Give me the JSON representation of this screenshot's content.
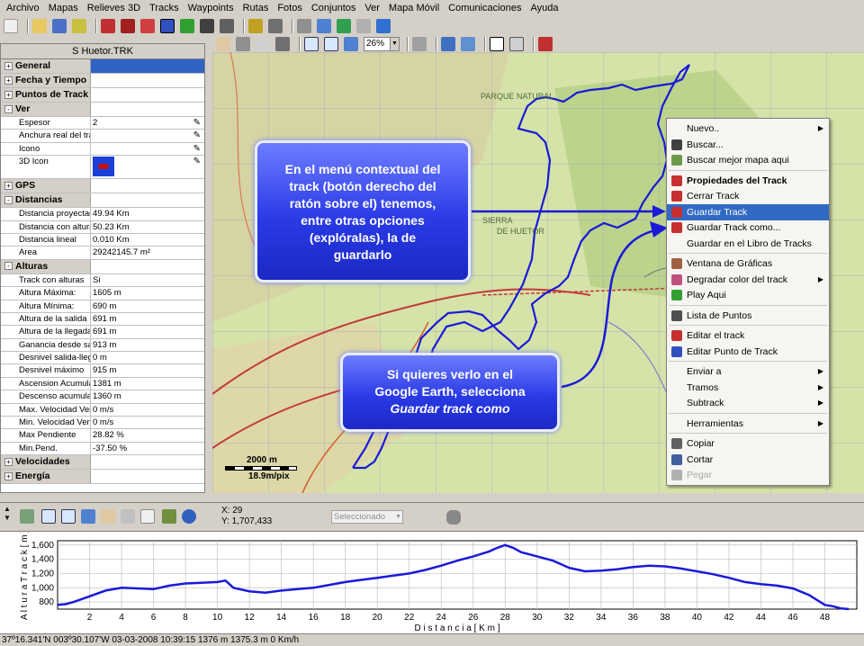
{
  "menubar": [
    "Archivo",
    "Mapas",
    "Relieves 3D",
    "Tracks",
    "Waypoints",
    "Rutas",
    "Fotos",
    "Conjuntos",
    "Ver",
    "Mapa Móvil",
    "Comunicaciones",
    "Ayuda"
  ],
  "toolbar": {
    "zoom": "26%"
  },
  "panel": {
    "title": "S Huetor.TRK",
    "rows": [
      {
        "type": "group",
        "label": "General",
        "pm": "+",
        "value": "",
        "selected": true
      },
      {
        "type": "group",
        "label": "Fecha y Tiempo",
        "pm": "+",
        "value": ""
      },
      {
        "type": "group",
        "label": "Puntos de Track",
        "pm": "+",
        "value": ""
      },
      {
        "type": "group",
        "label": "Ver",
        "pm": "-",
        "value": ""
      },
      {
        "type": "prop",
        "label": "Espesor",
        "value": "2",
        "pencil": true
      },
      {
        "type": "prop",
        "label": "Anchura real del track",
        "value": "",
        "pencil": true
      },
      {
        "type": "prop",
        "label": "Icono",
        "value": "",
        "pencil": true
      },
      {
        "type": "prop3d",
        "label": "3D Icon",
        "value": "",
        "pencil": true
      },
      {
        "type": "group",
        "label": "GPS",
        "pm": "+",
        "value": ""
      },
      {
        "type": "group",
        "label": "Distancias",
        "pm": "-",
        "value": ""
      },
      {
        "type": "prop",
        "label": "Distancia proyectada",
        "value": "49.94 Km"
      },
      {
        "type": "prop",
        "label": "Distancia con alturas",
        "value": "50.23 Km"
      },
      {
        "type": "prop",
        "label": "Distancia lineal",
        "value": "0.010 Km"
      },
      {
        "type": "prop",
        "label": "Area",
        "value": "29242145.7 m²"
      },
      {
        "type": "group",
        "label": "Alturas",
        "pm": "-",
        "value": ""
      },
      {
        "type": "prop",
        "label": "Track con alturas",
        "value": "Si"
      },
      {
        "type": "prop",
        "label": "Altura Máxima:",
        "value": "1605 m"
      },
      {
        "type": "prop",
        "label": "Altura Mínima:",
        "value": "690 m"
      },
      {
        "type": "prop",
        "label": "Altura de la salida",
        "value": "691 m"
      },
      {
        "type": "prop",
        "label": "Altura de la llegada",
        "value": "691 m"
      },
      {
        "type": "prop",
        "label": "Ganancia desde salida",
        "value": "913 m"
      },
      {
        "type": "prop",
        "label": "Desnivel salida-llegada",
        "value": "0 m"
      },
      {
        "type": "prop",
        "label": "Desnivel máximo",
        "value": "915 m"
      },
      {
        "type": "prop",
        "label": "Ascension Acumulada",
        "value": "1381 m"
      },
      {
        "type": "prop",
        "label": "Descenso acumulado",
        "value": "1360 m"
      },
      {
        "type": "prop",
        "label": "Max. Velocidad Vertical",
        "value": "0 m/s"
      },
      {
        "type": "prop",
        "label": "Min. Velocidad Vertical",
        "value": "0 m/s"
      },
      {
        "type": "prop",
        "label": "Max Pendiente",
        "value": "28.82 %"
      },
      {
        "type": "prop",
        "label": "Min.Pend.",
        "value": "-37.50 %"
      },
      {
        "type": "group",
        "label": "Velocidades",
        "pm": "+",
        "value": ""
      },
      {
        "type": "group",
        "label": "Energía",
        "pm": "+",
        "value": ""
      }
    ]
  },
  "map": {
    "scale_label": "2000 m",
    "resolution": "18.9m/pix",
    "labels": [
      "PARQUE NATURAL",
      "SIERRA",
      "DE HUETOR"
    ]
  },
  "context_menu": [
    {
      "label": "Nuevo..",
      "arrow": true,
      "icon": null
    },
    {
      "label": "Buscar...",
      "icon": "binoculars-icon"
    },
    {
      "label": "Buscar mejor mapa aqui",
      "icon": "map-search-icon"
    },
    {
      "sep": true
    },
    {
      "label": "Propiedades del Track",
      "bold": true,
      "icon": "track-icon"
    },
    {
      "label": "Cerrar Track",
      "icon": "track-icon"
    },
    {
      "label": "Guardar Track",
      "highlight": true,
      "icon": "track-save-icon"
    },
    {
      "label": "Guardar Track como...",
      "icon": "track-save-icon"
    },
    {
      "label": "Guardar en el Libro de Tracks",
      "icon": null
    },
    {
      "sep": true
    },
    {
      "label": "Ventana de Gráficas",
      "icon": "chart-icon"
    },
    {
      "label": "Degradar color del track",
      "arrow": true,
      "icon": "gradient-icon"
    },
    {
      "label": "Play Aqui",
      "icon": "play-icon"
    },
    {
      "sep": true
    },
    {
      "label": "Lista de Puntos",
      "icon": "list-icon"
    },
    {
      "sep": true
    },
    {
      "label": "Editar el track",
      "icon": "track-edit-icon"
    },
    {
      "label": "Editar Punto de Track",
      "icon": "point-edit-icon"
    },
    {
      "sep": true
    },
    {
      "label": "Enviar a",
      "arrow": true,
      "icon": null
    },
    {
      "label": "Tramos",
      "arrow": true,
      "icon": null
    },
    {
      "label": "Subtrack",
      "arrow": true,
      "icon": null
    },
    {
      "sep": true
    },
    {
      "label": "Herramientas",
      "arrow": true,
      "icon": null
    },
    {
      "sep": true
    },
    {
      "label": "Copiar",
      "icon": "copy-icon"
    },
    {
      "label": "Cortar",
      "icon": "cut-icon"
    },
    {
      "label": "Pegar",
      "disabled": true,
      "icon": "paste-icon"
    }
  ],
  "callouts": {
    "c1": [
      "En el menú contextual del",
      "track (botón derecho del",
      "ratón sobre el) tenemos,",
      "entre otras opciones",
      "(explóralas), la de",
      "guardarlo"
    ],
    "c2_lines": [
      "Si quieres verlo en el",
      "Google Earth, selecciona"
    ],
    "c2_italic": "Guardar track como"
  },
  "profile_toolbar": {
    "x": "X: 29",
    "y": "Y: 1,707,433",
    "select": "Seleccionado"
  },
  "colors": {
    "track": "#1a1ad8",
    "menu_highlight": "#316ac5",
    "callout": "#2a3be6"
  },
  "chart_data": {
    "type": "line",
    "xlabel": "D i s t a n c i a   [ K m ]",
    "ylabel": "A l t u r a   T r a c k   [ m ]",
    "xlim": [
      0,
      50
    ],
    "ylim": [
      700,
      1660
    ],
    "x_ticks": [
      2,
      4,
      6,
      8,
      10,
      12,
      14,
      16,
      18,
      20,
      22,
      24,
      26,
      28,
      30,
      32,
      34,
      36,
      38,
      40,
      42,
      44,
      46,
      48
    ],
    "y_ticks": [
      800,
      1000,
      1200,
      1400,
      1600
    ],
    "y_tick_labels": [
      "800",
      "1,000",
      "1,200",
      "1,400",
      "1,600"
    ],
    "series": [
      {
        "x": [
          0,
          0.5,
          1,
          2,
          3,
          4,
          5,
          6,
          7,
          8,
          9,
          10,
          10.5,
          11,
          12,
          13,
          14,
          15,
          16,
          17,
          18,
          19,
          20,
          21,
          22,
          23,
          24,
          25,
          26,
          27,
          27.5,
          28,
          28.5,
          29,
          30,
          31,
          32,
          33,
          34,
          35,
          36,
          37,
          38,
          39,
          40,
          41,
          42,
          43,
          44,
          45,
          46,
          47,
          48,
          48.5,
          49,
          49.5
        ],
        "y": [
          760,
          770,
          800,
          880,
          960,
          1000,
          990,
          980,
          1030,
          1060,
          1070,
          1080,
          1100,
          1000,
          950,
          930,
          960,
          980,
          1000,
          1040,
          1080,
          1110,
          1140,
          1170,
          1200,
          1250,
          1310,
          1380,
          1440,
          1510,
          1560,
          1600,
          1560,
          1500,
          1440,
          1380,
          1280,
          1230,
          1240,
          1260,
          1290,
          1310,
          1300,
          1270,
          1230,
          1190,
          1140,
          1080,
          1050,
          1030,
          990,
          900,
          760,
          740,
          710,
          700
        ]
      }
    ]
  },
  "statusbar": {
    "text": "37º16.341'N 003º30.107'W  03-03-2008  10:39:15  1376 m  1375.3 m  0 Km/h"
  }
}
